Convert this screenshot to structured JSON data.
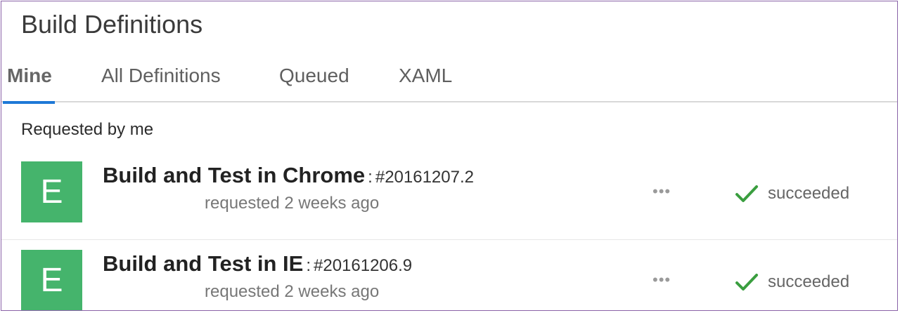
{
  "page": {
    "title": "Build Definitions"
  },
  "tabs": [
    {
      "label": "Mine",
      "active": true
    },
    {
      "label": "All Definitions",
      "active": false
    },
    {
      "label": "Queued",
      "active": false
    },
    {
      "label": "XAML",
      "active": false
    }
  ],
  "section": {
    "label": "Requested by me"
  },
  "builds": [
    {
      "avatar_letter": "E",
      "name": "Build and Test in Chrome",
      "separator": ":",
      "build_number": "#20161207.2",
      "requested": "requested 2 weeks ago",
      "more": "•••",
      "status": "succeeded",
      "status_icon": "checkmark-icon"
    },
    {
      "avatar_letter": "E",
      "name": "Build and Test in IE",
      "separator": ":",
      "build_number": "#20161206.9",
      "requested": "requested 2 weeks ago",
      "more": "•••",
      "status": "succeeded",
      "status_icon": "checkmark-icon"
    }
  ],
  "colors": {
    "avatar_bg": "#45b46c",
    "active_tab_underline": "#1e78d6",
    "success": "#3a9e3f",
    "frame_border": "#8a63a8"
  }
}
